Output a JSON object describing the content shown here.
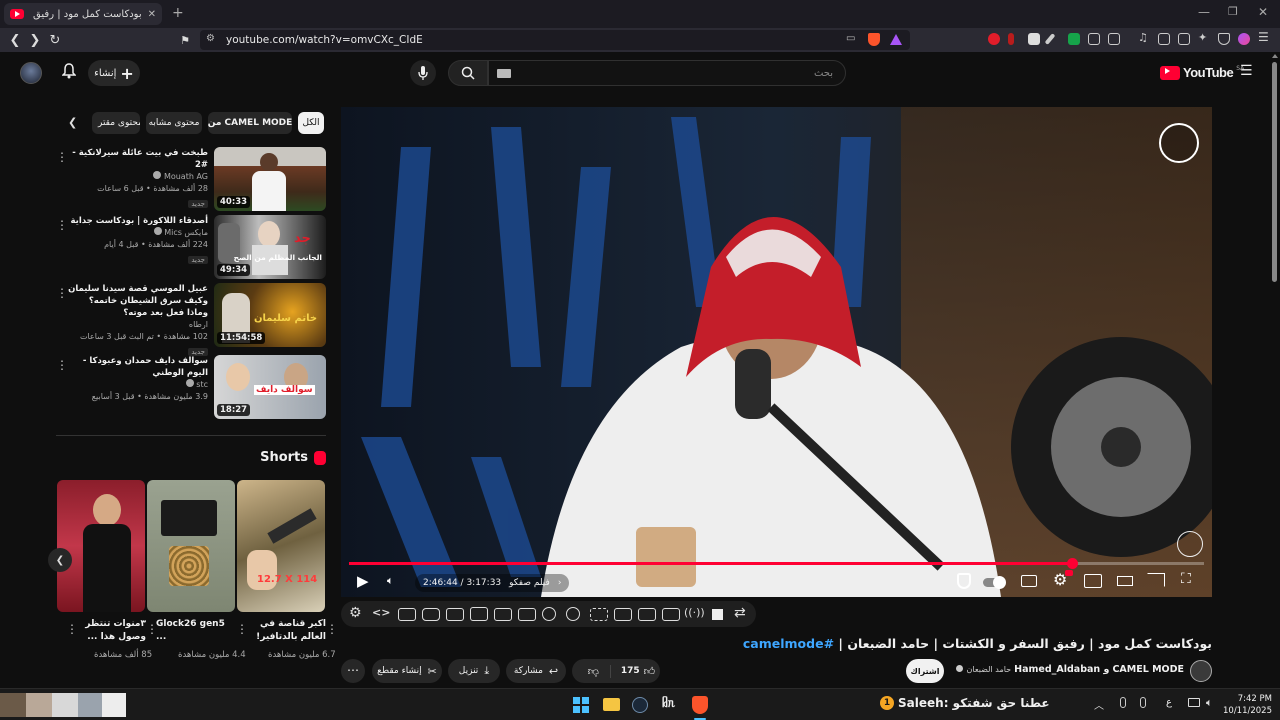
{
  "browser": {
    "tab_title": "بودكاست كمل مود | رفيق السفر و",
    "url": "youtube.com/watch?v=omvCXc_CIdE"
  },
  "header": {
    "logo_text": "YouTube",
    "logo_region": "SA",
    "search_placeholder": "بحث",
    "create_label": "إنشاء"
  },
  "chips": [
    "الكل",
    "من CAMEL MODE",
    "محتوى مشابه",
    "محتوى مقتر"
  ],
  "recommendations": [
    {
      "title": "طبخت في بيت عائلة سيرلانكية - #2",
      "channel": "Mouath AG",
      "meta": "28 ألف مشاهدة • قبل 6 ساعات",
      "badge": "جديد",
      "duration": "40:33",
      "thumb_text": ""
    },
    {
      "title": "أصدقاء اللاكورة | بودكاست جداية",
      "channel": "مايكس Mics",
      "meta": "224 ألف مشاهدة • قبل 4 أيام",
      "badge": "جديد",
      "duration": "49:34",
      "thumb_text": "الجانب المظلم من الصح"
    },
    {
      "title": "عبيل الموسي قصة سيدنا سليمان وكيف سرق الشيطان خاتمه؟ وماذا فعل بعد موته؟",
      "channel": "ارطاه",
      "meta": "102 مشاهدة • تم البث قبل 3 ساعات",
      "badge": "جديد",
      "duration": "11:54:58",
      "thumb_text": "خاتم سليمان"
    },
    {
      "title": "سوالف دايف حمدان وعبودكا - اليوم الوطني",
      "channel": "stc",
      "meta": "3.9 مليون مشاهدة • قبل 3 أسابيع",
      "badge": "",
      "duration": "18:27",
      "thumb_text": "سوالف دايف"
    }
  ],
  "shorts": {
    "heading": "Shorts",
    "items": [
      {
        "title": "اكبر قناصة في العالم بالدتافير!",
        "views": "6.7 مليون مشاهدة",
        "overlay": "12.7 X 114"
      },
      {
        "title": "Glock26 gen5 ...",
        "views": "4.4 مليون مشاهدة",
        "overlay": ""
      },
      {
        "title": "٣منوات تنتظر وصول هذا ...",
        "views": "85 ألف مشاهدة",
        "overlay": ""
      }
    ]
  },
  "player": {
    "time": "2:46:44 / 3:17:33",
    "chapter": "فيلم صفكو",
    "progress": 0.8455,
    "accent": "#ff0033"
  },
  "video": {
    "title": "بودكاست كمل مود | رفيق السفر و الكشتات | حامد الضبعان |",
    "hashtag": "#camelmode",
    "channel": "CAMEL MODE",
    "collab": "و Hamed_Aldaban",
    "collab2": "حامد الضبعان",
    "subscribe": "اشتراك",
    "likes": "175",
    "share": "مشاركة",
    "download": "تنزيل",
    "clip": "إنشاء مقطع"
  },
  "taskbar": {
    "ticker": "عطنا حق شفتكو :Saleeh",
    "ticker_badge": "1",
    "lang": "ع",
    "time": "7:42 PM",
    "date": "10/11/2025"
  }
}
